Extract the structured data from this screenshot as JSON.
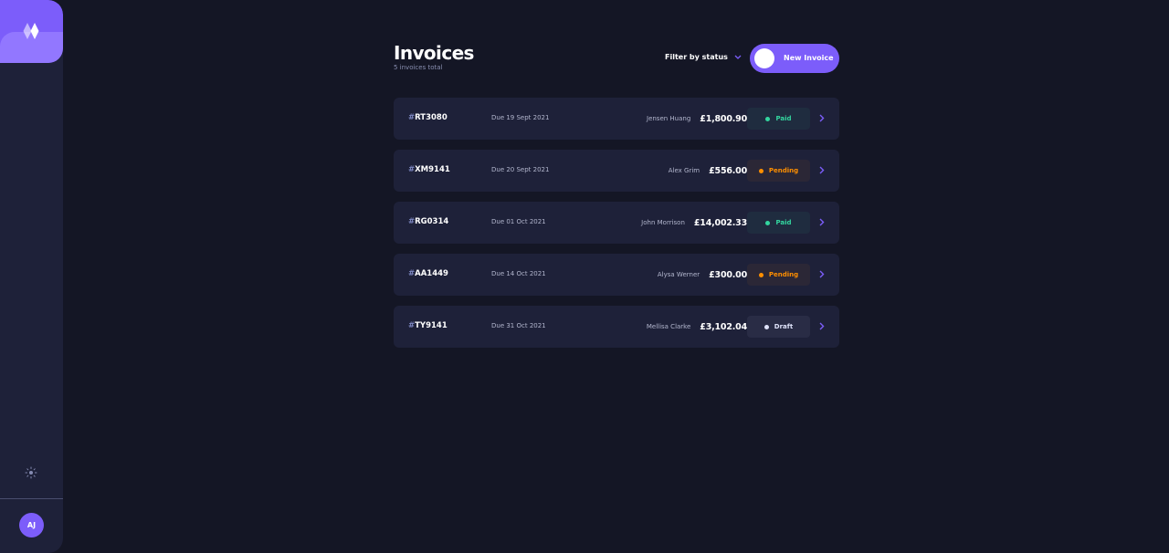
{
  "header": {
    "title": "Invoices",
    "subtitle": "5 invoices total",
    "filter_label": "Filter by status",
    "new_invoice_label": "New Invoice"
  },
  "user": {
    "initials": "AJ"
  },
  "colors": {
    "accent": "#7c5dfa",
    "paid": "#33d69f",
    "pending": "#ff8f00",
    "draft": "#dfe3fa"
  },
  "invoices": [
    {
      "hash": "#",
      "id": "RT3080",
      "due": "Due 19 Sept 2021",
      "client": "Jensen Huang",
      "amount": "£1,800.90",
      "status": "Paid",
      "status_key": "paid"
    },
    {
      "hash": "#",
      "id": "XM9141",
      "due": "Due 20 Sept 2021",
      "client": "Alex Grim",
      "amount": "£556.00",
      "status": "Pending",
      "status_key": "pending"
    },
    {
      "hash": "#",
      "id": "RG0314",
      "due": "Due 01 Oct 2021",
      "client": "John Morrison",
      "amount": "£14,002.33",
      "status": "Paid",
      "status_key": "paid"
    },
    {
      "hash": "#",
      "id": "AA1449",
      "due": "Due 14 Oct 2021",
      "client": "Alysa Werner",
      "amount": "£300.00",
      "status": "Pending",
      "status_key": "pending"
    },
    {
      "hash": "#",
      "id": "TY9141",
      "due": "Due 31 Oct 2021",
      "client": "Mellisa Clarke",
      "amount": "£3,102.04",
      "status": "Draft",
      "status_key": "draft"
    }
  ],
  "icons": {
    "logo": "logo-icon",
    "theme": "sun-icon",
    "filter": "chevron-down-icon",
    "new": "plus-icon",
    "row": "chevron-right-icon"
  }
}
